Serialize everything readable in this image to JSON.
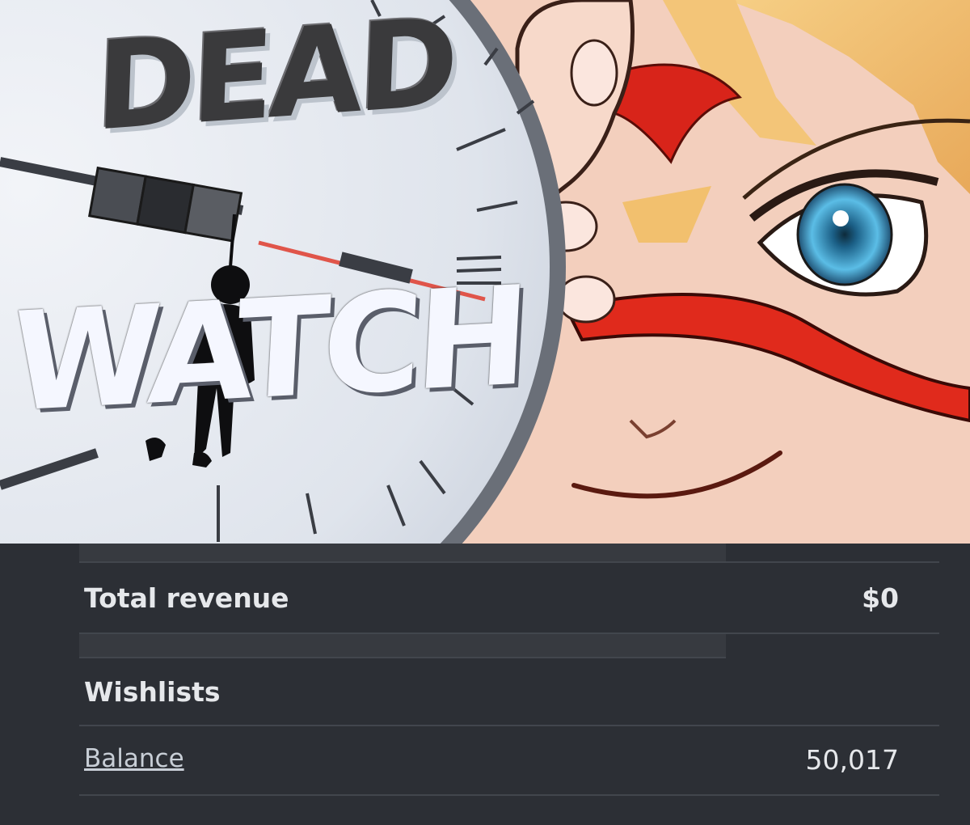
{
  "banner": {
    "title_line1": "DEAD",
    "title_line2": "WATCH"
  },
  "stats": {
    "total_revenue_label": "Total revenue",
    "total_revenue_value": "$0",
    "wishlists_label": "Wishlists",
    "balance_label": "Balance",
    "balance_value": "50,017"
  },
  "colors": {
    "panel_bg": "#2c2f35",
    "text": "#e6e8eb",
    "accent_red": "#d8241a",
    "eye_blue": "#3f9ed0"
  }
}
